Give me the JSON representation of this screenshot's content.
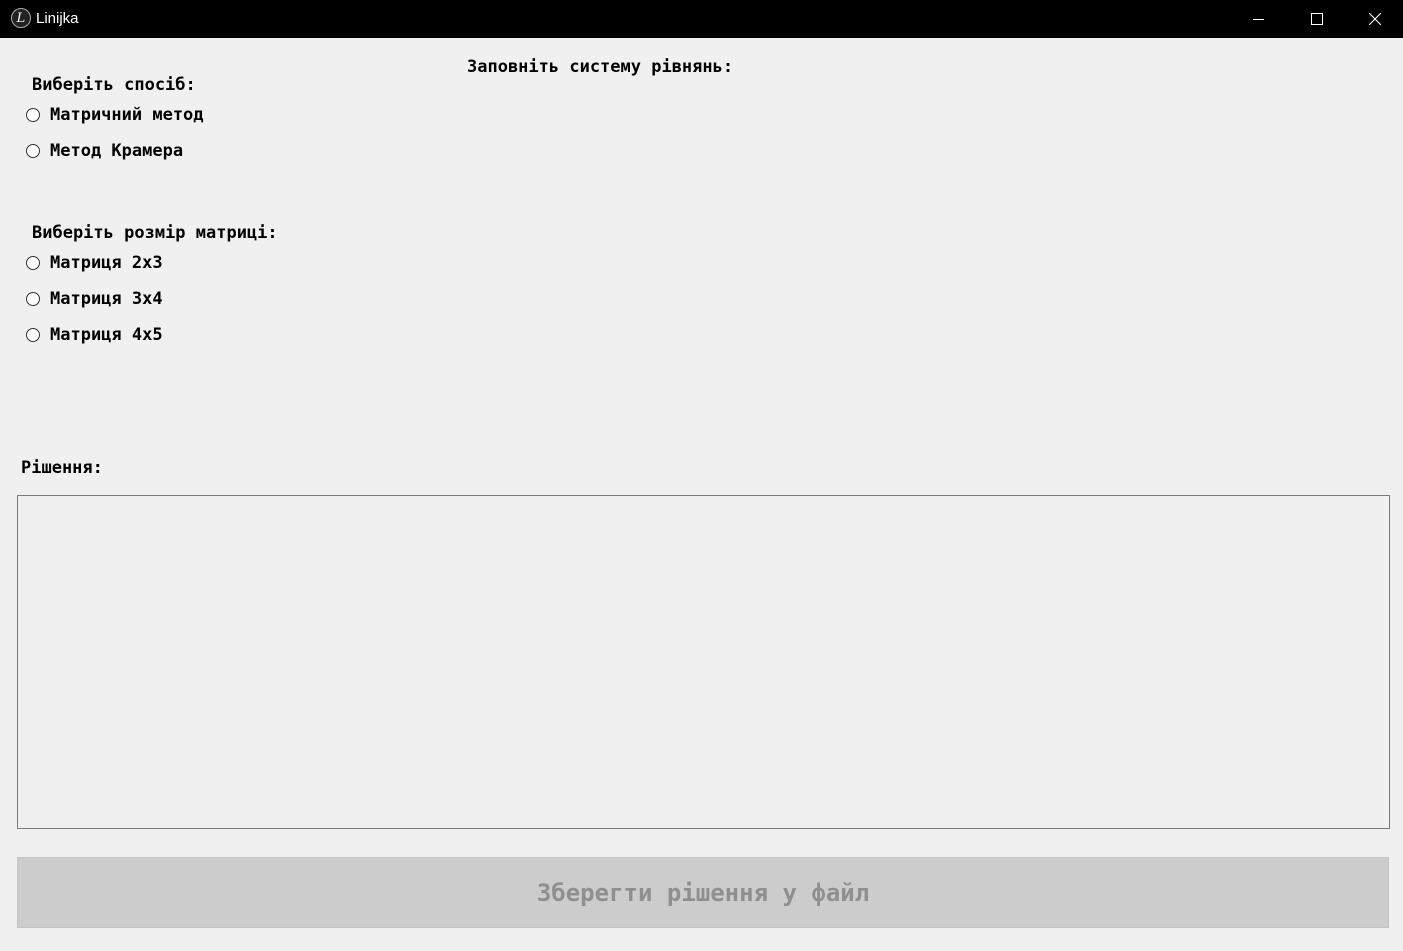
{
  "window": {
    "title": "Linijka",
    "icon_letter": "L"
  },
  "controls": {
    "minimize": "minimize-icon",
    "maximize": "maximize-icon",
    "close": "close-icon"
  },
  "method": {
    "heading": "Виберіть спосіб:",
    "options": [
      {
        "label": "Матричний метод",
        "selected": false
      },
      {
        "label": "Метод Крамера",
        "selected": false
      }
    ]
  },
  "size": {
    "heading": "Виберіть розмір матриці:",
    "options": [
      {
        "label": "Матриця 2x3",
        "selected": false
      },
      {
        "label": "Матриця 3x4",
        "selected": false
      },
      {
        "label": "Матриця 4x5",
        "selected": false
      }
    ]
  },
  "system": {
    "heading": "Заповніть систему рівнянь:"
  },
  "solution": {
    "heading": "Рішення:",
    "text": ""
  },
  "save": {
    "label": "Зберегти рішення у файл",
    "enabled": false
  },
  "colors": {
    "background": "#f0f0f0",
    "titlebar": "#000000",
    "button_disabled_bg": "#cccccc",
    "button_disabled_text": "#8f8f8f"
  }
}
